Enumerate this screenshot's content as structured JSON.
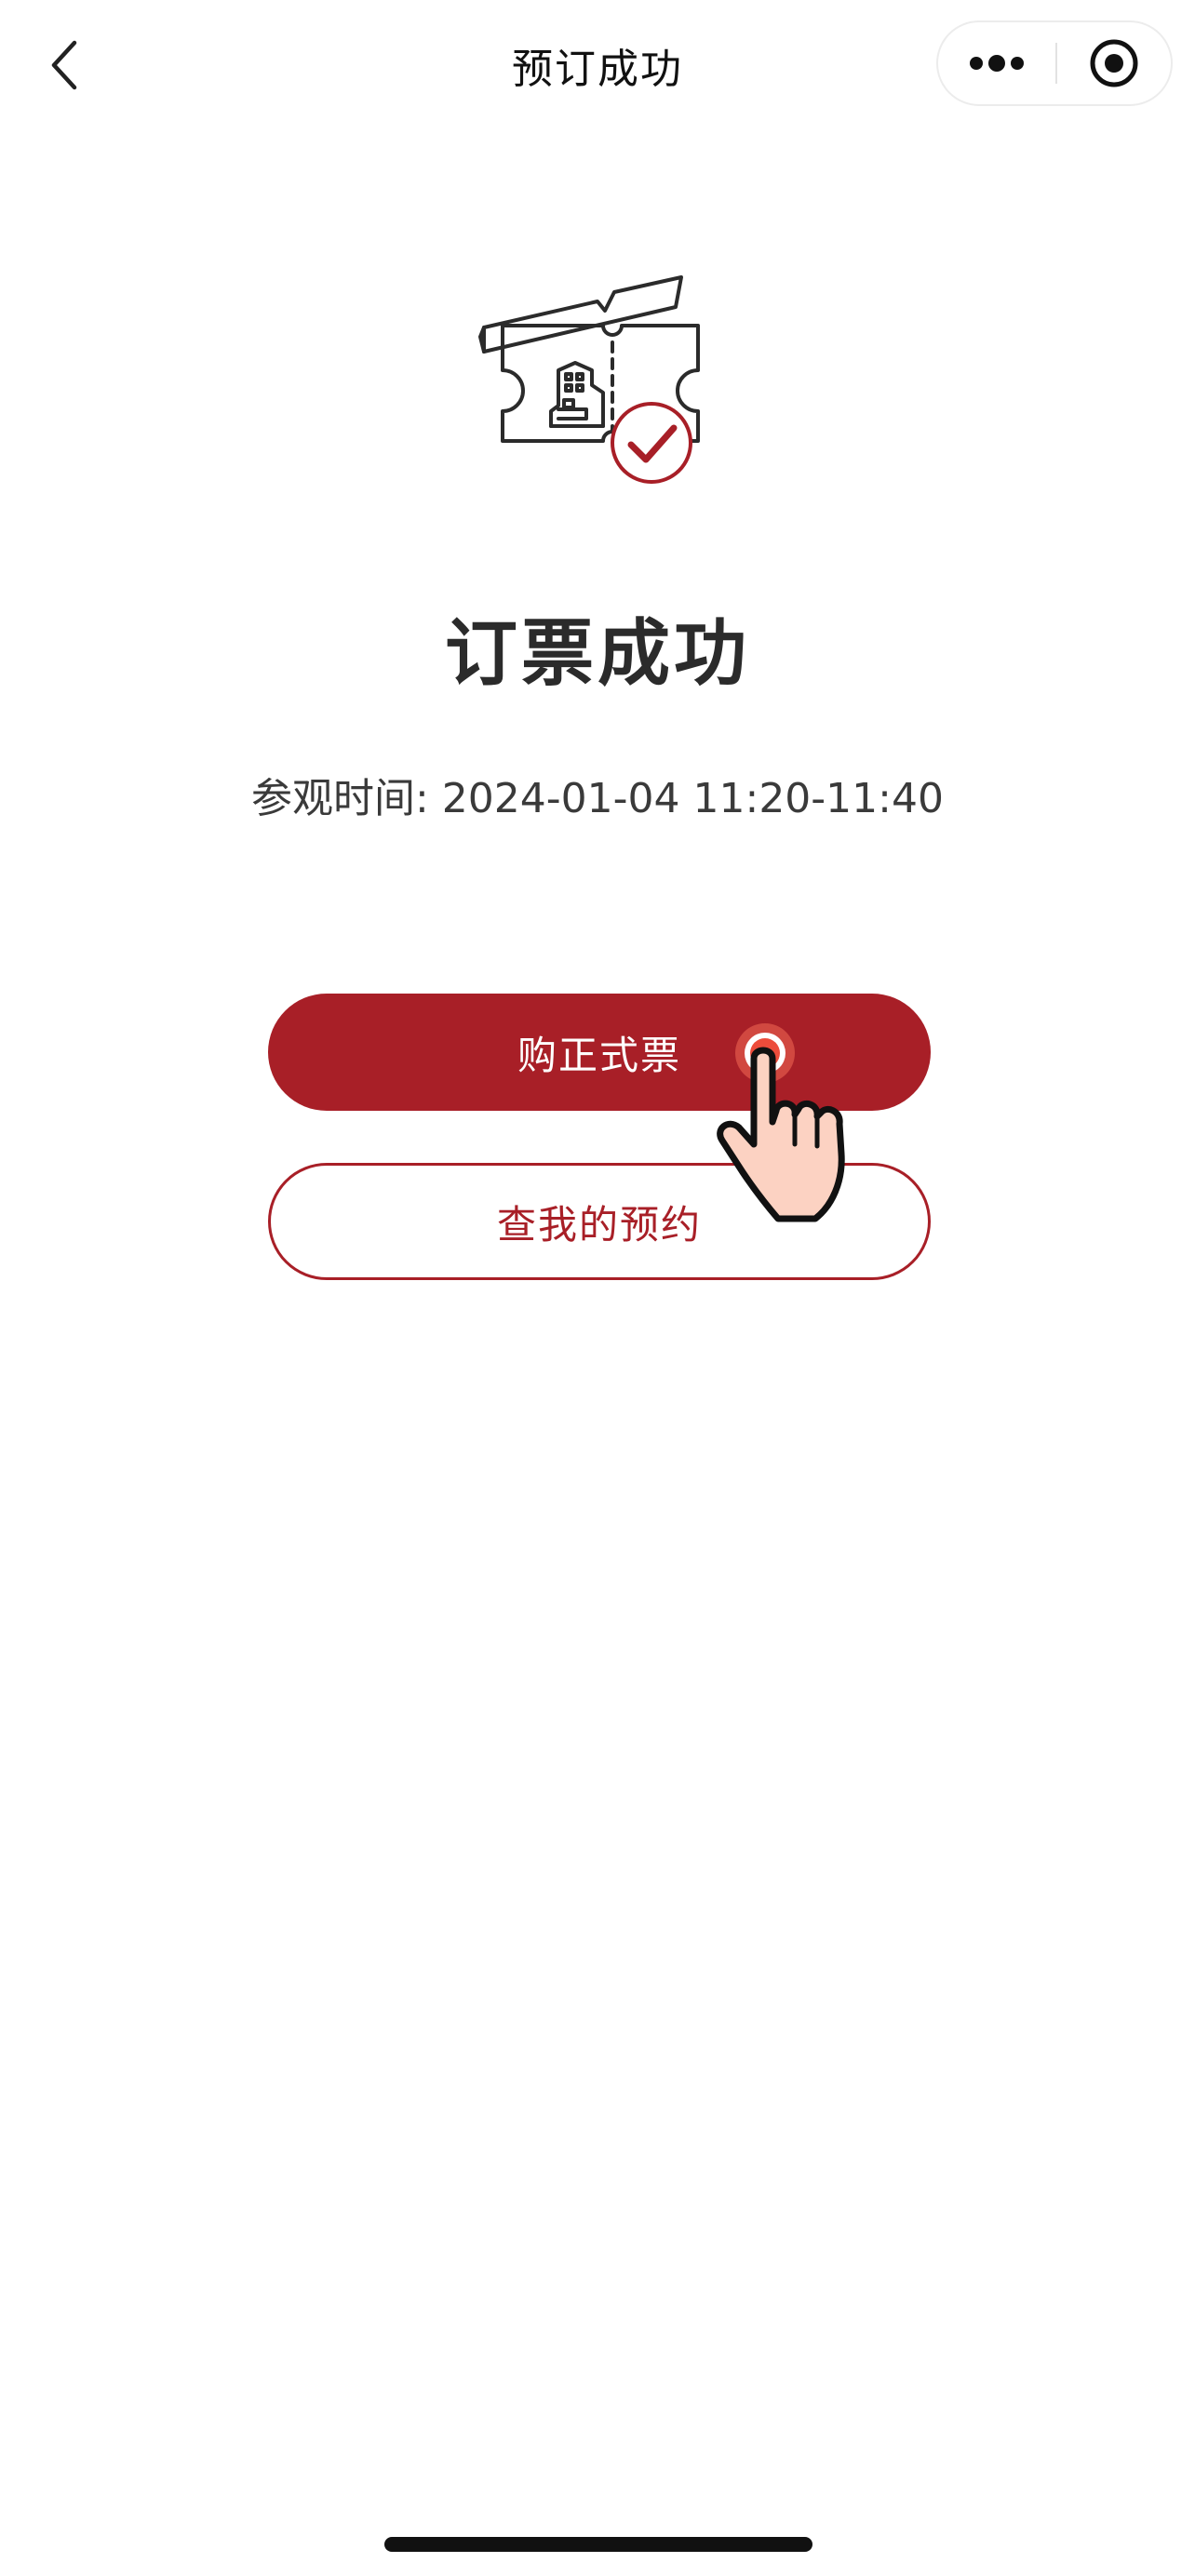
{
  "nav": {
    "title": "预订成功",
    "back_icon": "chevron-left-icon",
    "more_icon": "more-dots-icon",
    "close_icon": "target-close-icon"
  },
  "main": {
    "illustration_icon": "ticket-success-icon",
    "title": "订票成功",
    "visit_time": "参观时间: 2024-01-04 11:20-11:40"
  },
  "actions": {
    "primary_label": "购正式票",
    "secondary_label": "查我的预约"
  },
  "colors": {
    "accent": "#a81f27",
    "background": "#ffffff",
    "text": "#2b2b2b"
  }
}
